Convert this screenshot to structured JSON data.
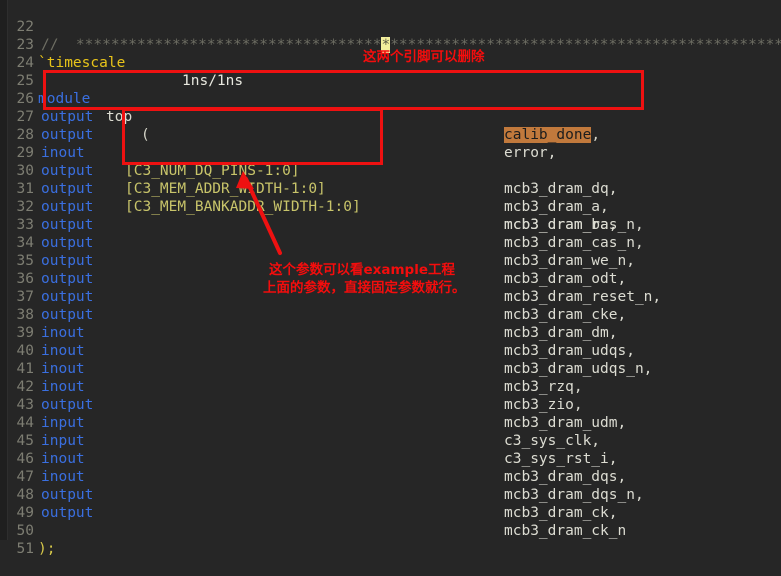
{
  "editor": {
    "background": "#262626",
    "gutter_color": "#7d7d72",
    "first_line": 22,
    "last_line": 51
  },
  "code": {
    "line22": {
      "num": "22",
      "comment_prefix": "//  ",
      "stars_before": "***********************************",
      "star_highlighted": "*",
      "stars_after": "************************************************************************"
    },
    "line23": {
      "num": "23",
      "directive": "`timescale",
      "value": "1ns/1ns"
    },
    "line24": {
      "num": "24"
    },
    "line25": {
      "num": "25",
      "kw": "module",
      "name": "top",
      "paren": "("
    },
    "line26": {
      "num": "26",
      "kw": "output",
      "signal": "calib_done",
      "comma": ","
    },
    "line27": {
      "num": "27",
      "kw": "output",
      "signal": "error,"
    },
    "line28": {
      "num": "28",
      "kw": "inout",
      "range": "[C3_NUM_DQ_PINS-1:0]",
      "signal": "mcb3_dram_dq,"
    },
    "line29": {
      "num": "29",
      "kw": "output",
      "range": "[C3_MEM_ADDR_WIDTH-1:0]",
      "signal": "mcb3_dram_a,"
    },
    "line30": {
      "num": "30",
      "kw": "output",
      "range": "[C3_MEM_BANKADDR_WIDTH-1:0]",
      "signal": "mcb3_dram_ba,"
    },
    "line31": {
      "num": "31",
      "kw": "output",
      "signal": "mcb3_dram_ras_n,"
    },
    "line32": {
      "num": "32",
      "kw": "output",
      "signal": "mcb3_dram_cas_n,"
    },
    "line33": {
      "num": "33",
      "kw": "output",
      "signal": "mcb3_dram_we_n,"
    },
    "line34": {
      "num": "34",
      "kw": "output",
      "signal": "mcb3_dram_odt,"
    },
    "line35": {
      "num": "35",
      "kw": "output",
      "signal": "mcb3_dram_reset_n,"
    },
    "line36": {
      "num": "36",
      "kw": "output",
      "signal": "mcb3_dram_cke,"
    },
    "line37": {
      "num": "37",
      "kw": "output",
      "signal": "mcb3_dram_dm,"
    },
    "line38": {
      "num": "38",
      "kw": "inout",
      "signal": "mcb3_dram_udqs,"
    },
    "line39": {
      "num": "39",
      "kw": "inout",
      "signal": "mcb3_dram_udqs_n,"
    },
    "line40": {
      "num": "40",
      "kw": "inout",
      "signal": "mcb3_rzq,"
    },
    "line41": {
      "num": "41",
      "kw": "inout",
      "signal": "mcb3_zio,"
    },
    "line42": {
      "num": "42",
      "kw": "output",
      "signal": "mcb3_dram_udm,"
    },
    "line43": {
      "num": "43",
      "kw": "input",
      "signal": "c3_sys_clk,"
    },
    "line44": {
      "num": "44",
      "kw": "input",
      "signal": "c3_sys_rst_i,"
    },
    "line45": {
      "num": "45",
      "kw": "inout",
      "signal": "mcb3_dram_dqs,"
    },
    "line46": {
      "num": "46",
      "kw": "inout",
      "signal": "mcb3_dram_dqs_n,"
    },
    "line47": {
      "num": "47",
      "kw": "output",
      "signal": "mcb3_dram_ck,"
    },
    "line48": {
      "num": "48",
      "kw": "output",
      "signal": "mcb3_dram_ck_n"
    },
    "line49": {
      "num": "49"
    },
    "line50": {
      "num": "50",
      "close": ");"
    },
    "line51": {
      "num": "51"
    }
  },
  "annotations": {
    "color": "#f40d0d",
    "note_top": "这两个引脚可以删除",
    "note_bottom_line1": "这个参数可以看example工程",
    "note_bottom_line2": "上面的参数，直接固定参数就行。"
  },
  "highlights": {
    "find_match": "calib_done",
    "find_bg": "#c1793c",
    "cursor_bg": "#f2ee9c"
  }
}
